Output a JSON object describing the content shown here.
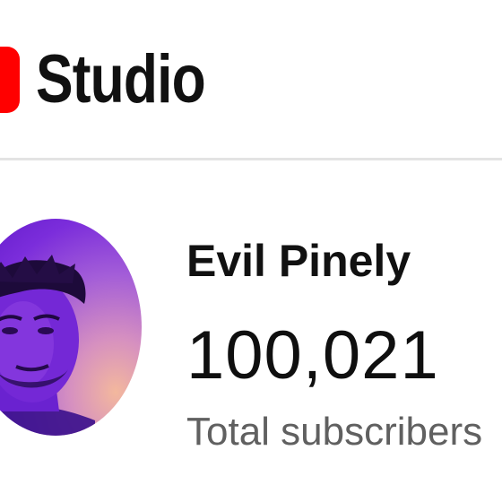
{
  "header": {
    "logo_icon": "youtube-play-logo-icon",
    "brand_text": "Studio",
    "brand_color": "#ff0000"
  },
  "channel": {
    "name": "Evil Pinely",
    "subscriber_count": "100,021",
    "subscriber_label": "Total subscribers",
    "avatar_icon": "channel-avatar-photo"
  }
}
